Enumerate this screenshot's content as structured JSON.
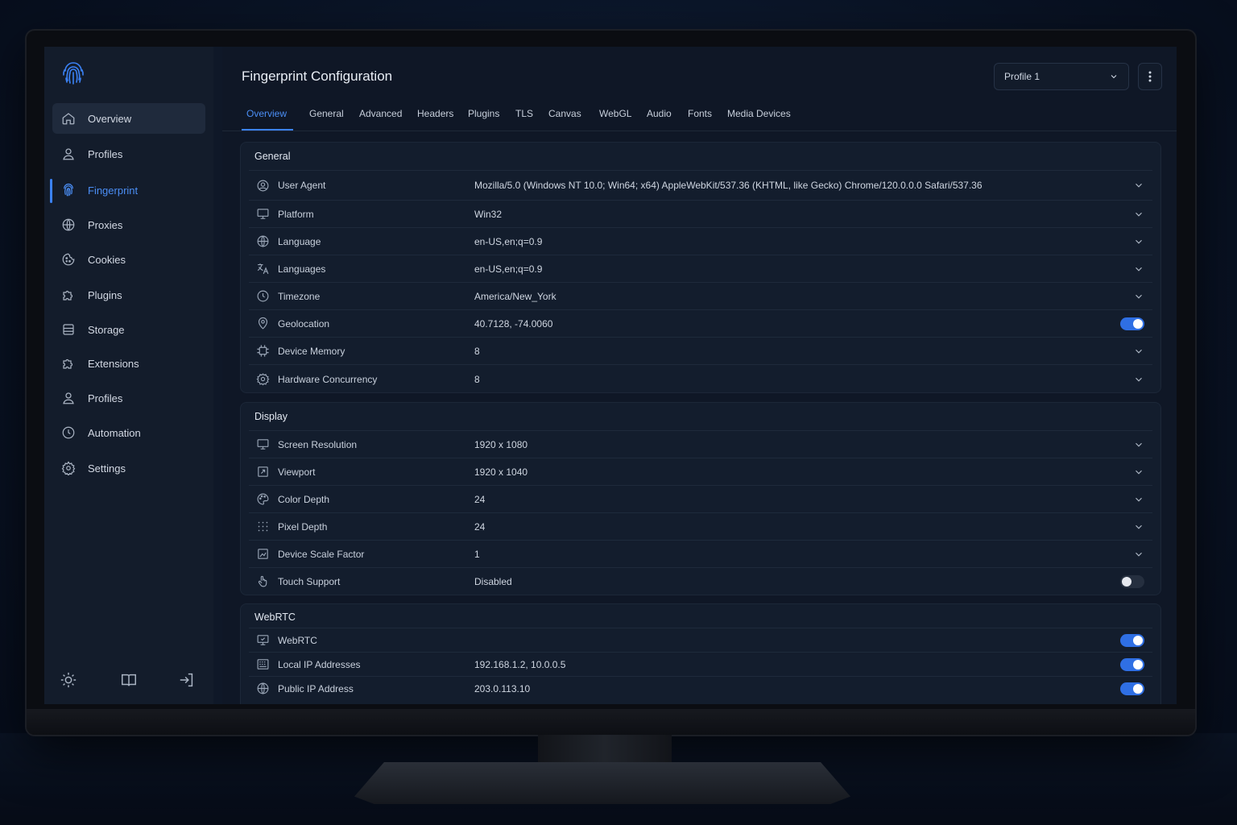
{
  "app": {
    "logo_icon": "fingerprint-icon",
    "accent": "#3b82f6"
  },
  "sidebar": {
    "items": [
      {
        "label": "Overview",
        "icon": "home-icon"
      },
      {
        "label": "Profiles",
        "icon": "user-icon"
      },
      {
        "label": "Fingerprint",
        "icon": "fingerprint-icon"
      },
      {
        "label": "Proxies",
        "icon": "globe-icon"
      },
      {
        "label": "Cookies",
        "icon": "cookie-icon"
      },
      {
        "label": "Plugins",
        "icon": "puzzle-icon"
      },
      {
        "label": "Storage",
        "icon": "database-icon"
      },
      {
        "label": "Extensions",
        "icon": "puzzle-icon"
      },
      {
        "label": "Profiles",
        "icon": "user-icon"
      },
      {
        "label": "Automation",
        "icon": "clock-icon"
      },
      {
        "label": "Settings",
        "icon": "gear-icon"
      }
    ],
    "footer": [
      "sun-icon",
      "book-icon",
      "logout-icon"
    ]
  },
  "header": {
    "title": "Fingerprint Configuration",
    "profile_selected": "Profile 1"
  },
  "tabs": [
    "Overview",
    "General",
    "Advanced",
    "Headers",
    "Plugins",
    "TLS",
    "Canvas",
    "WebGL",
    "Audio",
    "Fonts",
    "Media Devices"
  ],
  "sections": {
    "general": {
      "title": "General",
      "rows": [
        {
          "label": "User Agent",
          "value": "Mozilla/5.0 (Windows NT 10.0; Win64; x64) AppleWebKit/537.36 (KHTML, like Gecko) Chrome/120.0.0.0 Safari/537.36",
          "control": "dropdown",
          "icon": "user-circle-icon"
        },
        {
          "label": "Platform",
          "value": "Win32",
          "control": "dropdown",
          "icon": "monitor-icon"
        },
        {
          "label": "Language",
          "value": "en-US,en;q=0.9",
          "control": "dropdown",
          "icon": "globe-icon"
        },
        {
          "label": "Languages",
          "value": "en-US,en;q=0.9",
          "control": "dropdown",
          "icon": "translate-icon"
        },
        {
          "label": "Timezone",
          "value": "America/New_York",
          "control": "dropdown",
          "icon": "clock-icon"
        },
        {
          "label": "Geolocation",
          "value": "40.7128, -74.0060",
          "control": "toggle",
          "enabled": true,
          "icon": "location-pin-icon"
        },
        {
          "label": "Device Memory",
          "value": "8",
          "control": "dropdown",
          "icon": "memory-chip-icon"
        },
        {
          "label": "Hardware Concurrency",
          "value": "8",
          "control": "dropdown",
          "icon": "cpu-icon"
        }
      ]
    },
    "display": {
      "title": "Display",
      "rows": [
        {
          "label": "Screen Resolution",
          "value": "1920 x 1080",
          "control": "dropdown",
          "icon": "monitor-icon"
        },
        {
          "label": "Viewport",
          "value": "1920 x 1040",
          "control": "dropdown",
          "icon": "viewport-icon"
        },
        {
          "label": "Color Depth",
          "value": "24",
          "control": "dropdown",
          "icon": "palette-icon"
        },
        {
          "label": "Pixel Depth",
          "value": "24",
          "control": "dropdown",
          "icon": "dots-grid-icon"
        },
        {
          "label": "Device Scale Factor",
          "value": "1",
          "control": "dropdown",
          "icon": "scale-icon"
        },
        {
          "label": "Touch Support",
          "value": "Disabled",
          "control": "toggle",
          "enabled": false,
          "icon": "touch-icon"
        }
      ]
    },
    "webrtc": {
      "title": "WebRTC",
      "rows": [
        {
          "label": "WebRTC",
          "value": "",
          "control": "toggle",
          "enabled": true,
          "icon": "webrtc-monitor-icon"
        },
        {
          "label": "Local IP Addresses",
          "value": "192.168.1.2, 10.0.0.5",
          "control": "toggle",
          "enabled": true,
          "icon": "network-grid-icon"
        },
        {
          "label": "Public IP Address",
          "value": "203.0.113.10",
          "control": "toggle",
          "enabled": true,
          "icon": "globe-icon"
        }
      ]
    }
  }
}
